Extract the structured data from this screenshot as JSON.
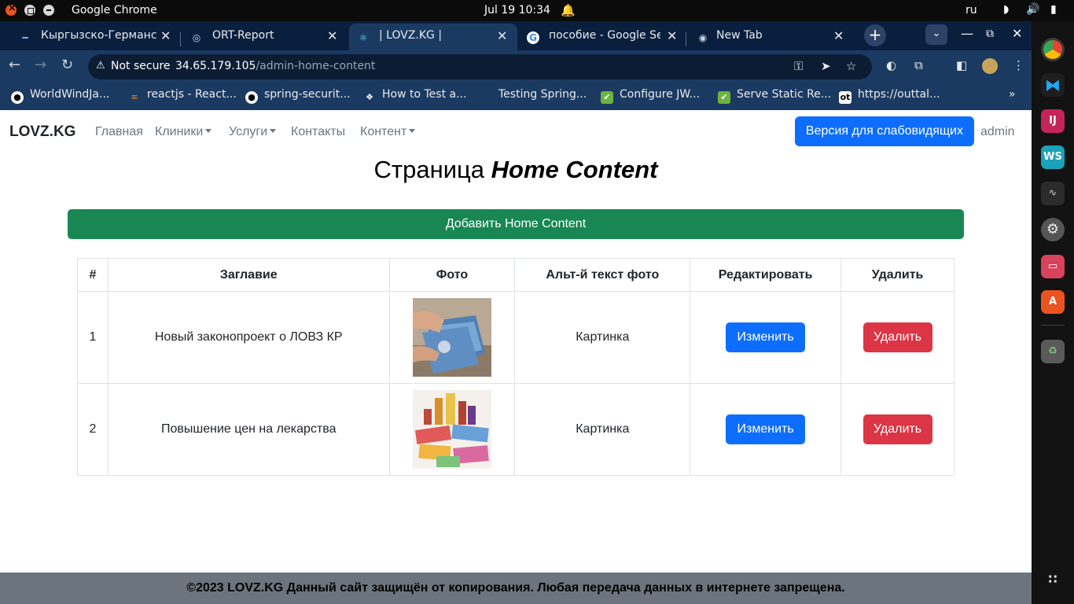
{
  "os": {
    "app_name": "Google Chrome",
    "clock": "Jul 19  10:34",
    "lang": "ru"
  },
  "tabs": [
    {
      "title": "Кыргызско-Германский",
      "icon": "dash-icon"
    },
    {
      "title": "ORT-Report",
      "icon": "globe-icon"
    },
    {
      "title": "| LOVZ.KG |",
      "icon": "react-icon"
    },
    {
      "title": "пособие - Google Search",
      "icon": "google-icon"
    },
    {
      "title": "New Tab",
      "icon": "chrome-icon"
    }
  ],
  "address": {
    "security": "Not secure",
    "host": "34.65.179.105",
    "path": "/admin-home-content"
  },
  "bookmarks": [
    {
      "label": "WorldWindJa...",
      "icon": "github-icon"
    },
    {
      "label": "reactjs - React...",
      "icon": "stackoverflow-icon"
    },
    {
      "label": "spring-securit...",
      "icon": "github-icon"
    },
    {
      "label": "How to Test a...",
      "icon": "bookmark-icon"
    },
    {
      "label": "Testing Spring...",
      "icon": ""
    },
    {
      "label": "Configure JW...",
      "icon": "leaf-icon"
    },
    {
      "label": "Serve Static Re...",
      "icon": "leaf-icon"
    },
    {
      "label": "https://outtal...",
      "icon": "ot-icon"
    }
  ],
  "site": {
    "brand": "LOVZ.KG",
    "nav": {
      "home": "Главная",
      "clinics": "Клиники",
      "services": "Услуги",
      "contacts": "Контакты",
      "content": "Контент"
    },
    "vision_button": "Версия для слабовидящих",
    "user": "admin",
    "heading_prefix": "Страница",
    "heading_italic": "Home Content",
    "add_button": "Добавить Home Content",
    "table": {
      "headers": [
        "#",
        "Заглавие",
        "Фото",
        "Альт-й текст фото",
        "Редактировать",
        "Удалить"
      ],
      "rows": [
        {
          "num": "1",
          "title": "Новый законопроект о ЛОВЗ КР",
          "photo": "money-photo",
          "alt": "Картинка",
          "edit": "Изменить",
          "delete": "Удалить"
        },
        {
          "num": "2",
          "title": "Повышение цен на лекарства",
          "photo": "medicine-photo",
          "alt": "Картинка",
          "edit": "Изменить",
          "delete": "Удалить"
        }
      ]
    },
    "footer": "©2023 LOVZ.KG Данный сайт защищён от копирования. Любая передача данных в интернете запрещена."
  },
  "colors": {
    "primary": "#0d6efd",
    "success": "#198754",
    "danger": "#dc3545",
    "footer_bg": "#6c757d",
    "chrome_frame": "#0a1f3e",
    "chrome_toolbar": "#1b3a62"
  }
}
